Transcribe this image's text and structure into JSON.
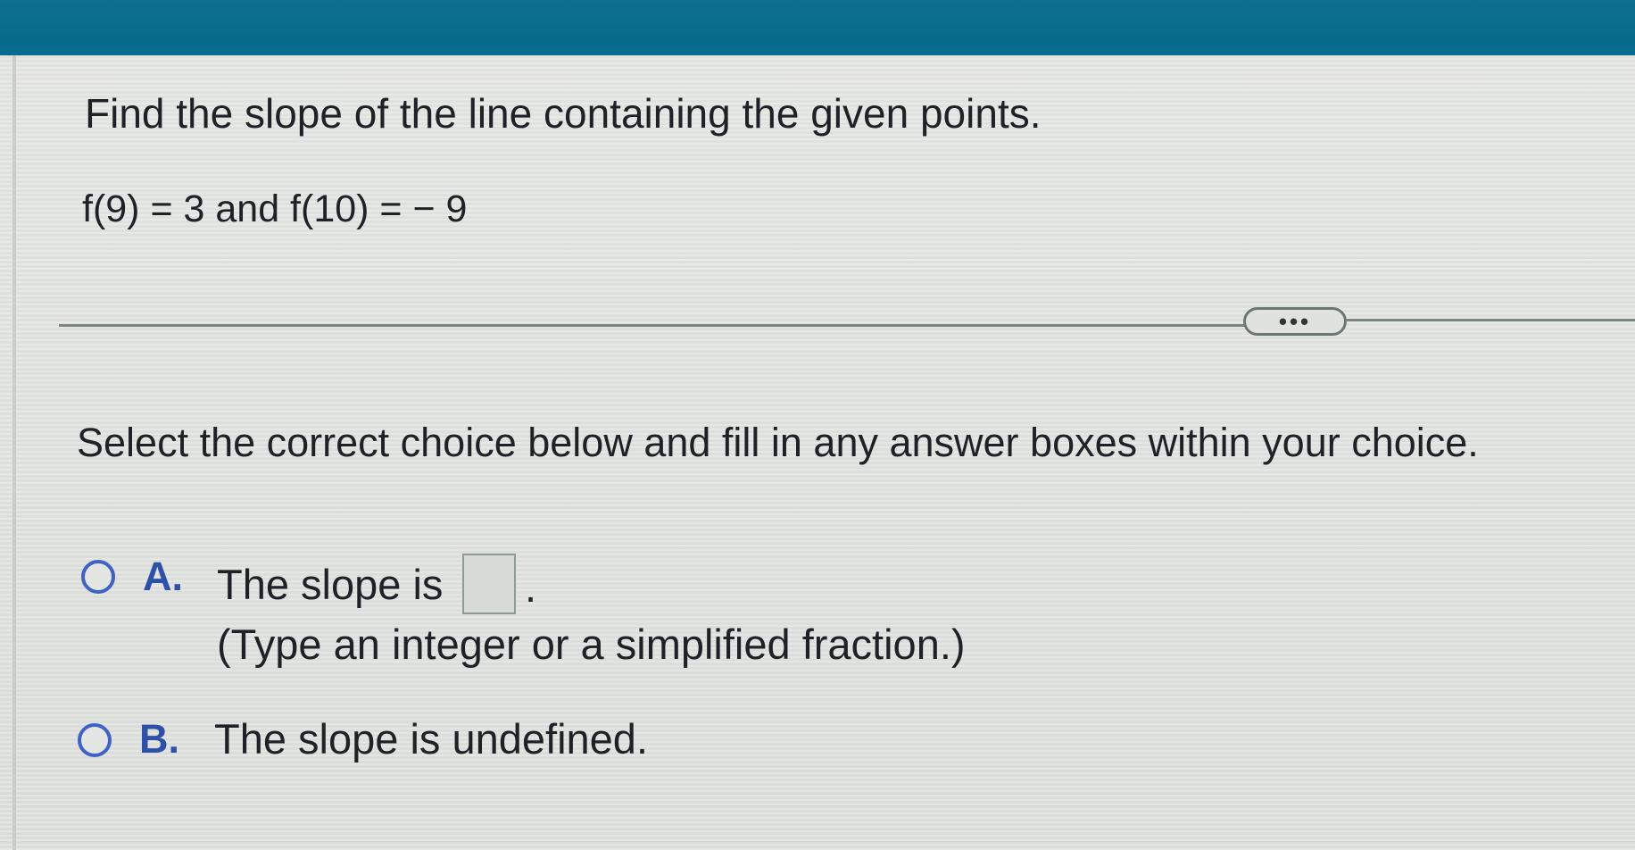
{
  "question": {
    "title": "Find the slope of the line containing the given points.",
    "given": "f(9) = 3 and f(10) = − 9"
  },
  "more_button": {
    "label": "•••"
  },
  "instructions": "Select the correct choice below and fill in any answer boxes within your choice.",
  "choices": [
    {
      "letter": "A.",
      "text": "The slope is",
      "answer_value": "",
      "suffix": ".",
      "hint": "(Type an integer or a simplified fraction.)",
      "selected": false
    },
    {
      "letter": "B.",
      "text": "The slope is undefined.",
      "selected": false
    }
  ],
  "colors": {
    "header": "#086a8b",
    "accent": "#3f63c4",
    "text": "#1e2226"
  }
}
